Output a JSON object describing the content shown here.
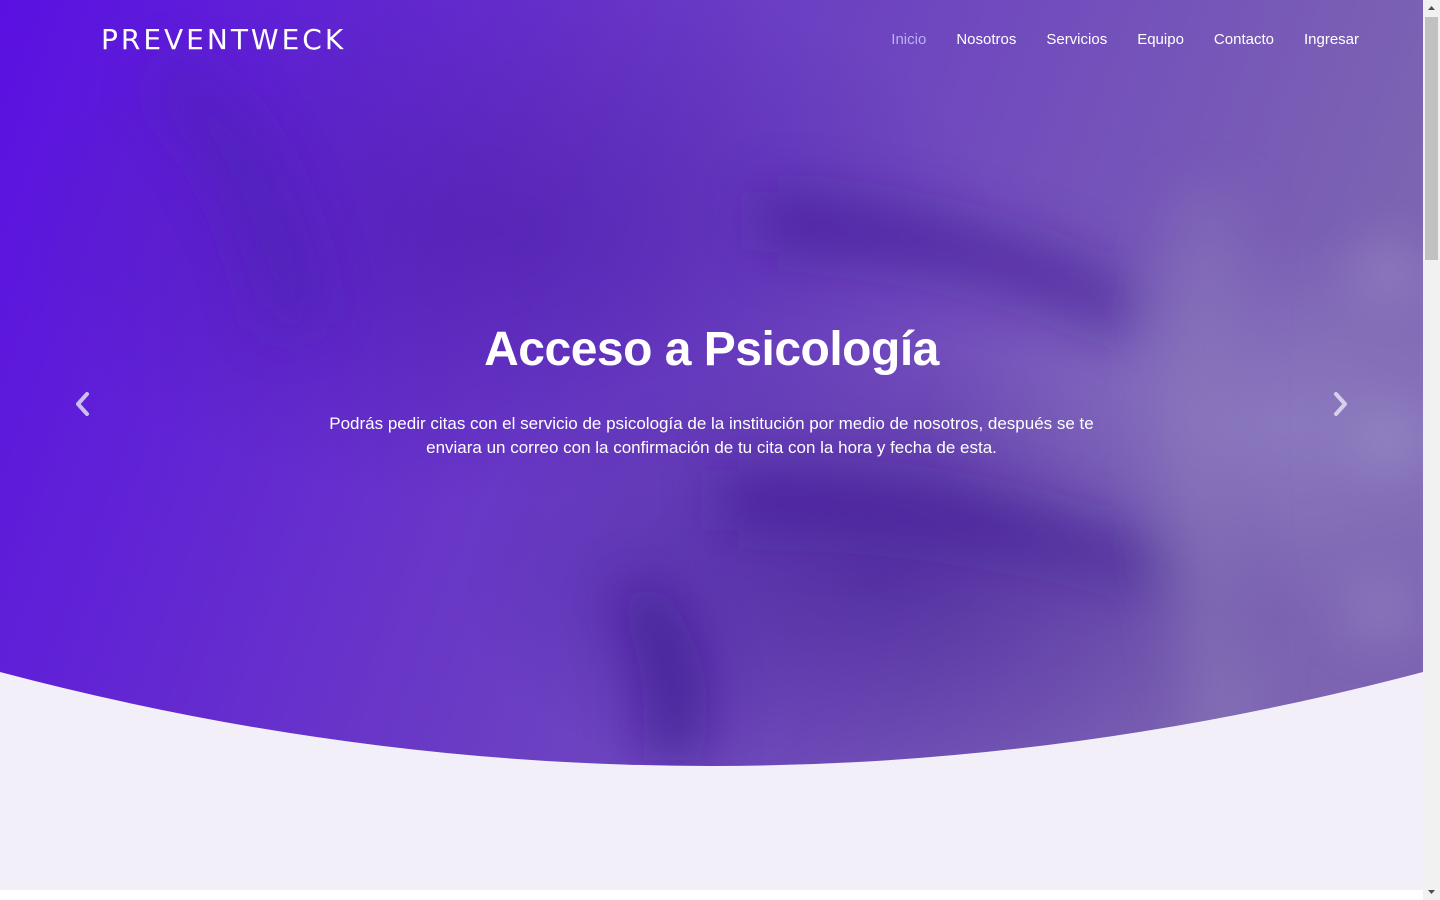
{
  "nav": {
    "brand": "PREVENTWECK",
    "items": [
      {
        "label": "Inicio",
        "active": true
      },
      {
        "label": "Nosotros",
        "active": false
      },
      {
        "label": "Servicios",
        "active": false
      },
      {
        "label": "Equipo",
        "active": false
      },
      {
        "label": "Contacto",
        "active": false
      },
      {
        "label": "Ingresar",
        "active": false
      }
    ]
  },
  "hero": {
    "title": "Acceso a Psicología",
    "description": "Podrás pedir citas con el servicio de psicología de la institución por medio de nosotros, después se te enviara un correo con la confirmación de tu cita con la hora y fecha de esta.",
    "prev_icon": "chevron-left-icon",
    "next_icon": "chevron-right-icon"
  },
  "colors": {
    "hero_gradient_start": "#5b12e0",
    "hero_gradient_end": "#7b5bb8",
    "page_background": "#f3eff9",
    "active_link": "#b8b4f0"
  }
}
